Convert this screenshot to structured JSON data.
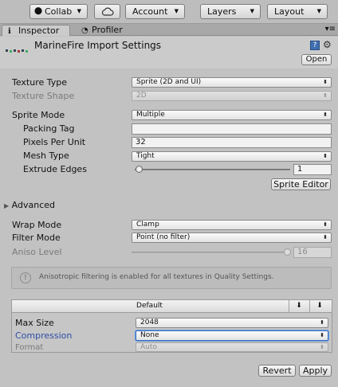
{
  "toolbar": {
    "collab_label": "Collab",
    "cloud_icon": "cloud-icon",
    "account_label": "Account",
    "layers_label": "Layers",
    "layout_label": "Layout"
  },
  "tabs": {
    "inspector_label": "Inspector",
    "profiler_label": "Profiler"
  },
  "header": {
    "title": "MarineFire Import Settings",
    "open_label": "Open"
  },
  "fields": {
    "texture_type_label": "Texture Type",
    "texture_type_value": "Sprite (2D and UI)",
    "texture_shape_label": "Texture Shape",
    "texture_shape_value": "2D",
    "sprite_mode_label": "Sprite Mode",
    "sprite_mode_value": "Multiple",
    "packing_tag_label": "Packing Tag",
    "packing_tag_value": "",
    "pixels_per_unit_label": "Pixels Per Unit",
    "pixels_per_unit_value": "32",
    "mesh_type_label": "Mesh Type",
    "mesh_type_value": "Tight",
    "extrude_edges_label": "Extrude Edges",
    "extrude_edges_value": "1",
    "sprite_editor_label": "Sprite Editor",
    "advanced_label": "Advanced",
    "wrap_mode_label": "Wrap Mode",
    "wrap_mode_value": "Clamp",
    "filter_mode_label": "Filter Mode",
    "filter_mode_value": "Point (no filter)",
    "aniso_level_label": "Aniso Level",
    "aniso_level_value": "16"
  },
  "help": {
    "text": "Anisotropic filtering is enabled for all textures in Quality Settings."
  },
  "platform": {
    "tab_label": "Default",
    "max_size_label": "Max Size",
    "max_size_value": "2048",
    "compression_label": "Compression",
    "compression_value": "None",
    "format_label": "Format",
    "format_value": "Auto"
  },
  "footer": {
    "revert_label": "Revert",
    "apply_label": "Apply"
  }
}
